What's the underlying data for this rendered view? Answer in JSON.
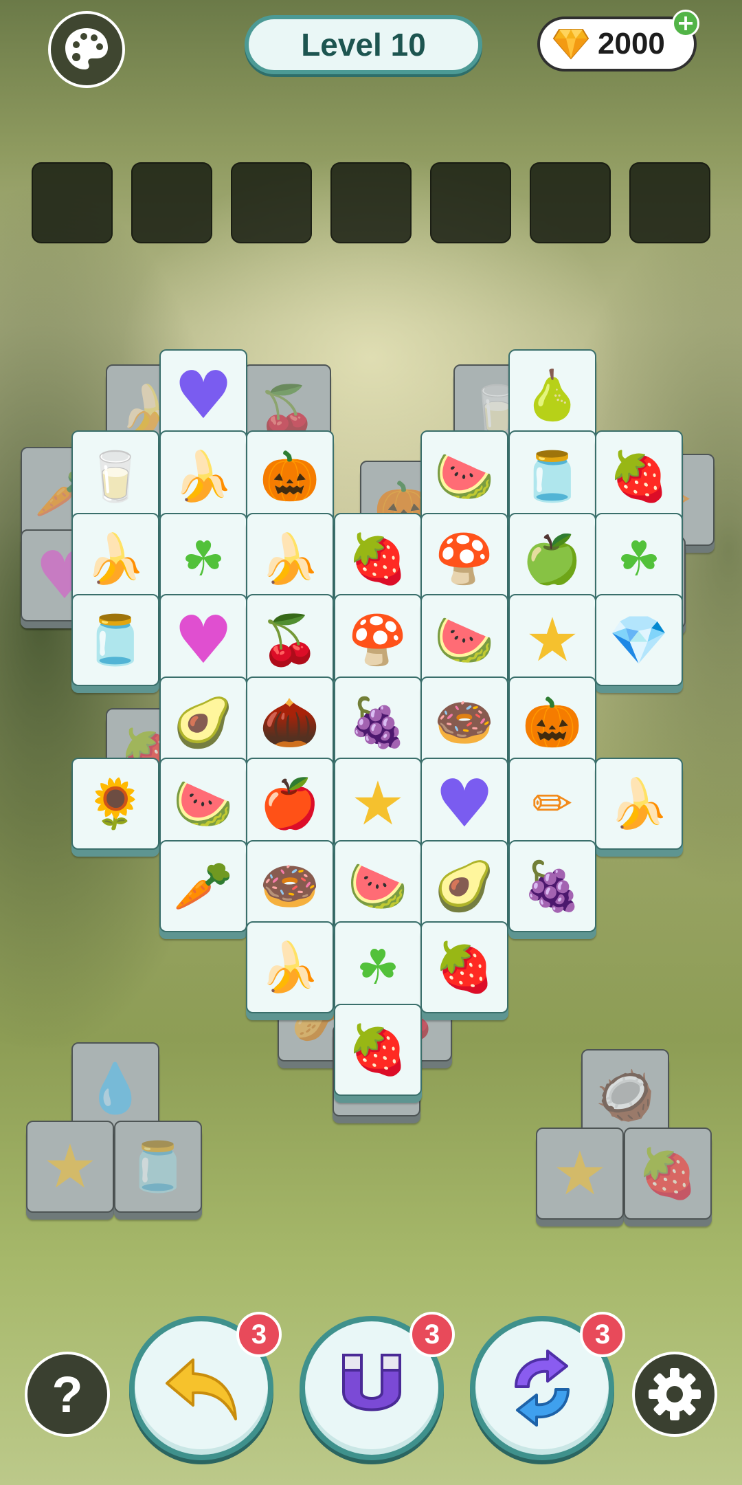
{
  "header": {
    "level_label": "Level 10",
    "gems": "2000",
    "palette_icon": "palette-icon",
    "gem_icon": "diamond-icon",
    "add_icon": "plus-icon"
  },
  "tray": {
    "slot_count": 7
  },
  "tiles": [
    {
      "icon": "banana",
      "glyph": "🍌",
      "dim": true
    },
    {
      "icon": "cherries",
      "glyph": "🍒",
      "dim": true
    },
    {
      "icon": "milk-bottle",
      "glyph": "🥛",
      "dim": true
    },
    {
      "icon": "carrot",
      "glyph": "🥕",
      "dim": true
    },
    {
      "icon": "water-jar",
      "glyph": "🫙",
      "dim": true
    },
    {
      "icon": "pumpkin",
      "glyph": "🎃",
      "dim": true
    },
    {
      "icon": "heart-pink",
      "glyph": "♥",
      "dim": true
    },
    {
      "icon": "strawberry",
      "glyph": "🍓",
      "dim": true
    },
    {
      "icon": "pencil",
      "glyph": "✏",
      "dim": true
    },
    {
      "icon": "water-jar",
      "glyph": "🫙",
      "dim": true
    },
    {
      "icon": "strawberry",
      "glyph": "🍓",
      "dim": true
    },
    {
      "icon": "cherries",
      "glyph": "🍒",
      "dim": true
    },
    {
      "icon": "almond",
      "glyph": "🥜",
      "dim": true
    },
    {
      "icon": "watermelon",
      "glyph": "🍉",
      "dim": true
    },
    {
      "icon": "pumpkin",
      "glyph": "🎃",
      "dim": true
    },
    {
      "icon": "heart-purple",
      "glyph": "♥",
      "dim": false
    },
    {
      "icon": "pear",
      "glyph": "🍐",
      "dim": false
    },
    {
      "icon": "milk-carton",
      "glyph": "🥛",
      "dim": false
    },
    {
      "icon": "banana",
      "glyph": "🍌",
      "dim": false
    },
    {
      "icon": "pumpkin",
      "glyph": "🎃",
      "dim": false
    },
    {
      "icon": "watermelon-slice",
      "glyph": "🍉",
      "dim": false
    },
    {
      "icon": "water-jar",
      "glyph": "🫙",
      "dim": false
    },
    {
      "icon": "strawberry",
      "glyph": "🍓",
      "dim": false
    },
    {
      "icon": "banana",
      "glyph": "🍌",
      "dim": false
    },
    {
      "icon": "clover-radish",
      "glyph": "☘",
      "dim": false
    },
    {
      "icon": "banana",
      "glyph": "🍌",
      "dim": false
    },
    {
      "icon": "strawberry",
      "glyph": "🍓",
      "dim": false
    },
    {
      "icon": "mushroom",
      "glyph": "🍄",
      "dim": false
    },
    {
      "icon": "green-apple",
      "glyph": "🍏",
      "dim": false
    },
    {
      "icon": "clover",
      "glyph": "☘",
      "dim": false
    },
    {
      "icon": "water-jar",
      "glyph": "🫙",
      "dim": false
    },
    {
      "icon": "heart-pink",
      "glyph": "♥",
      "dim": false
    },
    {
      "icon": "radish-cherries",
      "glyph": "🍒",
      "dim": false
    },
    {
      "icon": "mushroom",
      "glyph": "🍄",
      "dim": false
    },
    {
      "icon": "watermelon",
      "glyph": "🍉",
      "dim": false
    },
    {
      "icon": "star",
      "glyph": "★",
      "dim": false
    },
    {
      "icon": "diamond",
      "glyph": "💎",
      "dim": false
    },
    {
      "icon": "avocado",
      "glyph": "🥑",
      "dim": false
    },
    {
      "icon": "almond",
      "glyph": "🌰",
      "dim": false
    },
    {
      "icon": "grapes",
      "glyph": "🍇",
      "dim": false
    },
    {
      "icon": "donut",
      "glyph": "🍩",
      "dim": false
    },
    {
      "icon": "pumpkin",
      "glyph": "🎃",
      "dim": false
    },
    {
      "icon": "sunflower",
      "glyph": "🌻",
      "dim": false
    },
    {
      "icon": "watermelon-slice",
      "glyph": "🍉",
      "dim": false
    },
    {
      "icon": "apple-slice",
      "glyph": "🍎",
      "dim": false
    },
    {
      "icon": "star",
      "glyph": "★",
      "dim": false
    },
    {
      "icon": "heart-purple",
      "glyph": "♥",
      "dim": false
    },
    {
      "icon": "pencil",
      "glyph": "✏",
      "dim": false
    },
    {
      "icon": "banana",
      "glyph": "🍌",
      "dim": false
    },
    {
      "icon": "carrot",
      "glyph": "🥕",
      "dim": false
    },
    {
      "icon": "donut",
      "glyph": "🍩",
      "dim": false
    },
    {
      "icon": "watermelon",
      "glyph": "🍉",
      "dim": false
    },
    {
      "icon": "avocado",
      "glyph": "🥑",
      "dim": false
    },
    {
      "icon": "cloudberry",
      "glyph": "🍇",
      "dim": false
    },
    {
      "icon": "banana",
      "glyph": "🍌",
      "dim": false
    },
    {
      "icon": "clover-radish",
      "glyph": "☘",
      "dim": false
    },
    {
      "icon": "strawberry",
      "glyph": "🍓",
      "dim": false
    },
    {
      "icon": "strawberry",
      "glyph": "🍓",
      "dim": false
    },
    {
      "icon": "water-drop",
      "glyph": "💧",
      "dim": true
    },
    {
      "icon": "star",
      "glyph": "★",
      "dim": true
    },
    {
      "icon": "water-jar",
      "glyph": "🫙",
      "dim": true
    },
    {
      "icon": "coconut",
      "glyph": "🥥",
      "dim": true
    },
    {
      "icon": "star",
      "glyph": "★",
      "dim": true
    },
    {
      "icon": "strawberry",
      "glyph": "🍓",
      "dim": true
    }
  ],
  "boosters": [
    {
      "name": "undo",
      "icon": "undo-arrow-icon",
      "count": "3"
    },
    {
      "name": "magnet",
      "icon": "magnet-icon",
      "count": "3"
    },
    {
      "name": "shuffle",
      "icon": "shuffle-icon",
      "count": "3"
    }
  ],
  "footer": {
    "help_icon": "question-icon",
    "help_label": "?",
    "settings_icon": "gear-icon"
  },
  "colors": {
    "accent": "#4c9a95",
    "badge": "#e84a5a",
    "plus": "#52b447"
  }
}
